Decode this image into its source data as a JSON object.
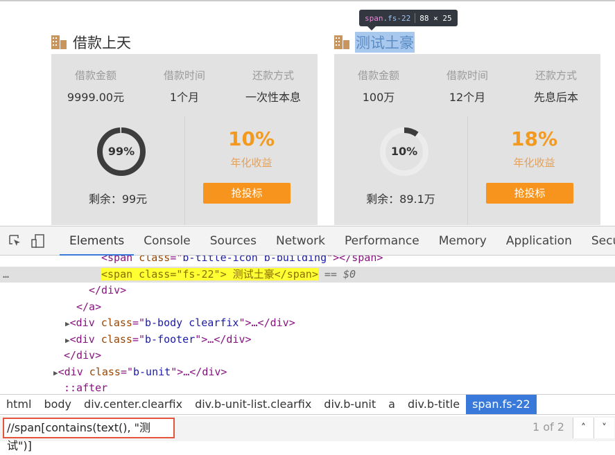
{
  "tooltip": {
    "tag": "span",
    "cls": ".fs-22",
    "size": "88 × 25"
  },
  "units": [
    {
      "title": "借款上天",
      "labels": [
        "借款金额",
        "借款时间",
        "还款方式"
      ],
      "values": [
        "9999.00元",
        "1个月",
        "一次性本息"
      ],
      "progress_percent": 99,
      "progress_label": "99%",
      "remaining": "剩余：99元",
      "rate": "10%",
      "rate_label": "年化收益",
      "button": "抢投标"
    },
    {
      "title": "测试土豪",
      "labels": [
        "借款金额",
        "借款时间",
        "还款方式"
      ],
      "values": [
        "100万",
        "12个月",
        "先息后本"
      ],
      "progress_percent": 10,
      "progress_label": "10%",
      "remaining": "剩余：89.1万",
      "rate": "18%",
      "rate_label": "年化收益",
      "button": "抢投标"
    }
  ],
  "devtools": {
    "tabs": [
      "Elements",
      "Console",
      "Sources",
      "Network",
      "Performance",
      "Memory",
      "Application",
      "Secur"
    ],
    "active_tab": "Elements",
    "code": {
      "l1a": "<span ",
      "l1b": "class",
      "l1c": "=\"",
      "l1d": "b-title-icon b-building",
      "l1e": "\"></span>",
      "l2": "<span class=\"fs-22\"> 测试土豪</span>",
      "l2b": " == $0",
      "dots": "…",
      "l3": "</div>",
      "l4": "</a>",
      "l5a": "<div ",
      "l5b": "class",
      "l5c": "=\"",
      "l5d": "b-body clearfix",
      "l5e": "\">…</div>",
      "l6d": "b-footer",
      "l7": "</div>",
      "l8d": "b-unit",
      "l9": "::after"
    },
    "breadcrumbs": [
      "html",
      "body",
      "div.center.clearfix",
      "div.b-unit-list.clearfix",
      "div.b-unit",
      "a",
      "div.b-title",
      "span.fs-22"
    ],
    "search": {
      "value": "//span[contains(text(), \"测试\")]",
      "count": "1 of 2"
    }
  },
  "colors": {
    "accent": "#f7941d",
    "ring": "#3d3d3d",
    "selection": "#3879d9"
  }
}
